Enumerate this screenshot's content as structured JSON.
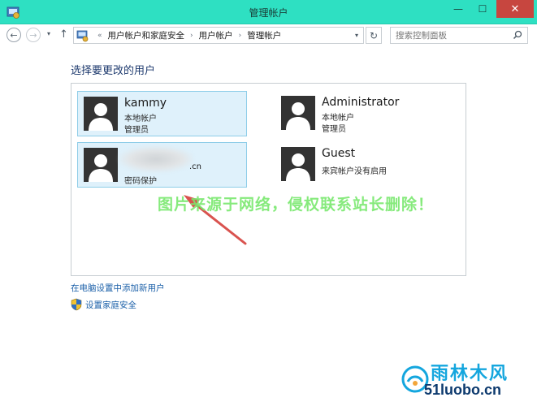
{
  "window": {
    "title": "管理帐户",
    "minimize": "—",
    "maximize": "☐",
    "close": "✕"
  },
  "nav": {
    "back": "←",
    "forward": "→",
    "dropdown": "▾",
    "up": "↑",
    "breadcrumb_prefix": "«",
    "breadcrumbs": [
      "用户帐户和家庭安全",
      "用户帐户",
      "管理帐户"
    ],
    "breadcrumb_sep": "›",
    "address_dropdown": "▾",
    "refresh": "↻",
    "search_placeholder": "搜索控制面板"
  },
  "main": {
    "heading": "选择要更改的用户",
    "accounts": [
      {
        "name": "kammy",
        "type": "本地帐户",
        "role": "管理员",
        "selected": true
      },
      {
        "name": "Administrator",
        "type": "本地帐户",
        "role": "管理员",
        "selected": false
      },
      {
        "name_suffix": ".cn",
        "role": "密码保护",
        "selected": true
      },
      {
        "name": "Guest",
        "type": "来宾帐户没有启用",
        "selected": false
      }
    ],
    "link_add_user": "在电脑设置中添加新用户",
    "link_family_safety": "设置家庭安全"
  },
  "overlay": {
    "watermark": "图片来源于网络，侵权联系站长删除！",
    "logo_name": "雨林木风",
    "logo_domain": "51luobo.cn"
  },
  "colors": {
    "titlebar": "#2ee0c2",
    "selection_bg": "#dff1fb",
    "selection_border": "#8ecde8",
    "link": "#1a5fa8",
    "heading": "#1e3a6e",
    "arrow": "#d9534f",
    "watermark": "#79e86e",
    "close_button": "#c7463f"
  }
}
